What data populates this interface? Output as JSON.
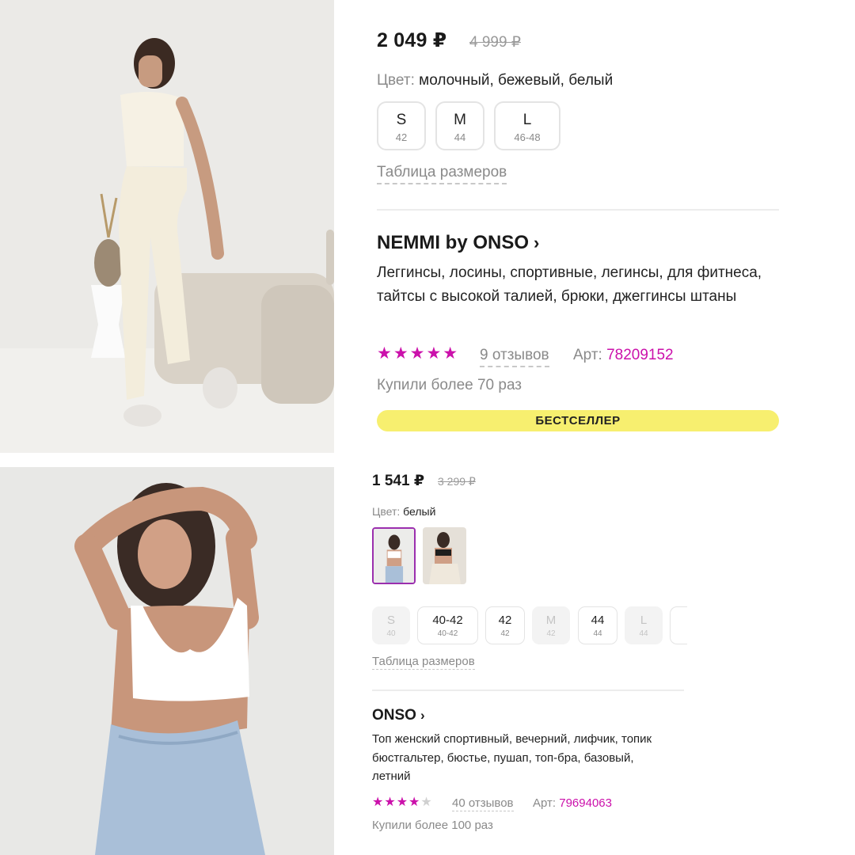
{
  "product_1": {
    "price": "2 049 ₽",
    "old_price": "4 999 ₽",
    "color_label": "Цвет:",
    "color_value": "молочный, бежевый, белый",
    "sizes": [
      {
        "size": "S",
        "ru": "42"
      },
      {
        "size": "M",
        "ru": "44"
      },
      {
        "size": "L",
        "ru": "46-48"
      }
    ],
    "size_table_link": "Таблица размеров",
    "brand": "NEMMI by ONSO",
    "title": "Леггинсы, лосины, спортивные, легинсы, для фитнеса, тайтсы с высокой талией, брюки, джеггинсы штаны",
    "rating_stars": "★★★★★",
    "rating": 5,
    "reviews": "9 отзывов",
    "article_label": "Арт:",
    "article_number": "78209152",
    "bought": "Купили более 70 раз",
    "badge": "БЕСТСЕЛЛЕР",
    "colors": {
      "accent": "#cb11ab",
      "badge_bg": "#f7ef6f"
    }
  },
  "product_2": {
    "price": "1 541 ₽",
    "old_price": "3 299 ₽",
    "color_label": "Цвет:",
    "color_value": "белый",
    "sizes": [
      {
        "size": "S",
        "ru": "40",
        "available": false
      },
      {
        "size": "40-42",
        "ru": "40-42",
        "available": true
      },
      {
        "size": "42",
        "ru": "42",
        "available": true
      },
      {
        "size": "M",
        "ru": "42",
        "available": false
      },
      {
        "size": "44",
        "ru": "44",
        "available": true
      },
      {
        "size": "L",
        "ru": "44",
        "available": false
      }
    ],
    "size_table_link": "Таблица размеров",
    "brand": "ONSO",
    "title": "Топ женский спортивный, вечерний, лифчик, топик бюстгальтер, бюстье, пушап, топ-бра, базовый, летний",
    "rating_stars_on": "★★★★",
    "rating_stars_off": "★",
    "rating": 4,
    "reviews": "40 отзывов",
    "article_label": "Арт:",
    "article_number": "79694063",
    "bought": "Купили более 100 раз",
    "colors": {
      "accent": "#cb11ab",
      "selected_border": "#9b2fae"
    }
  },
  "icons": {
    "chevron": "chevron-right-icon",
    "star": "star-icon"
  }
}
